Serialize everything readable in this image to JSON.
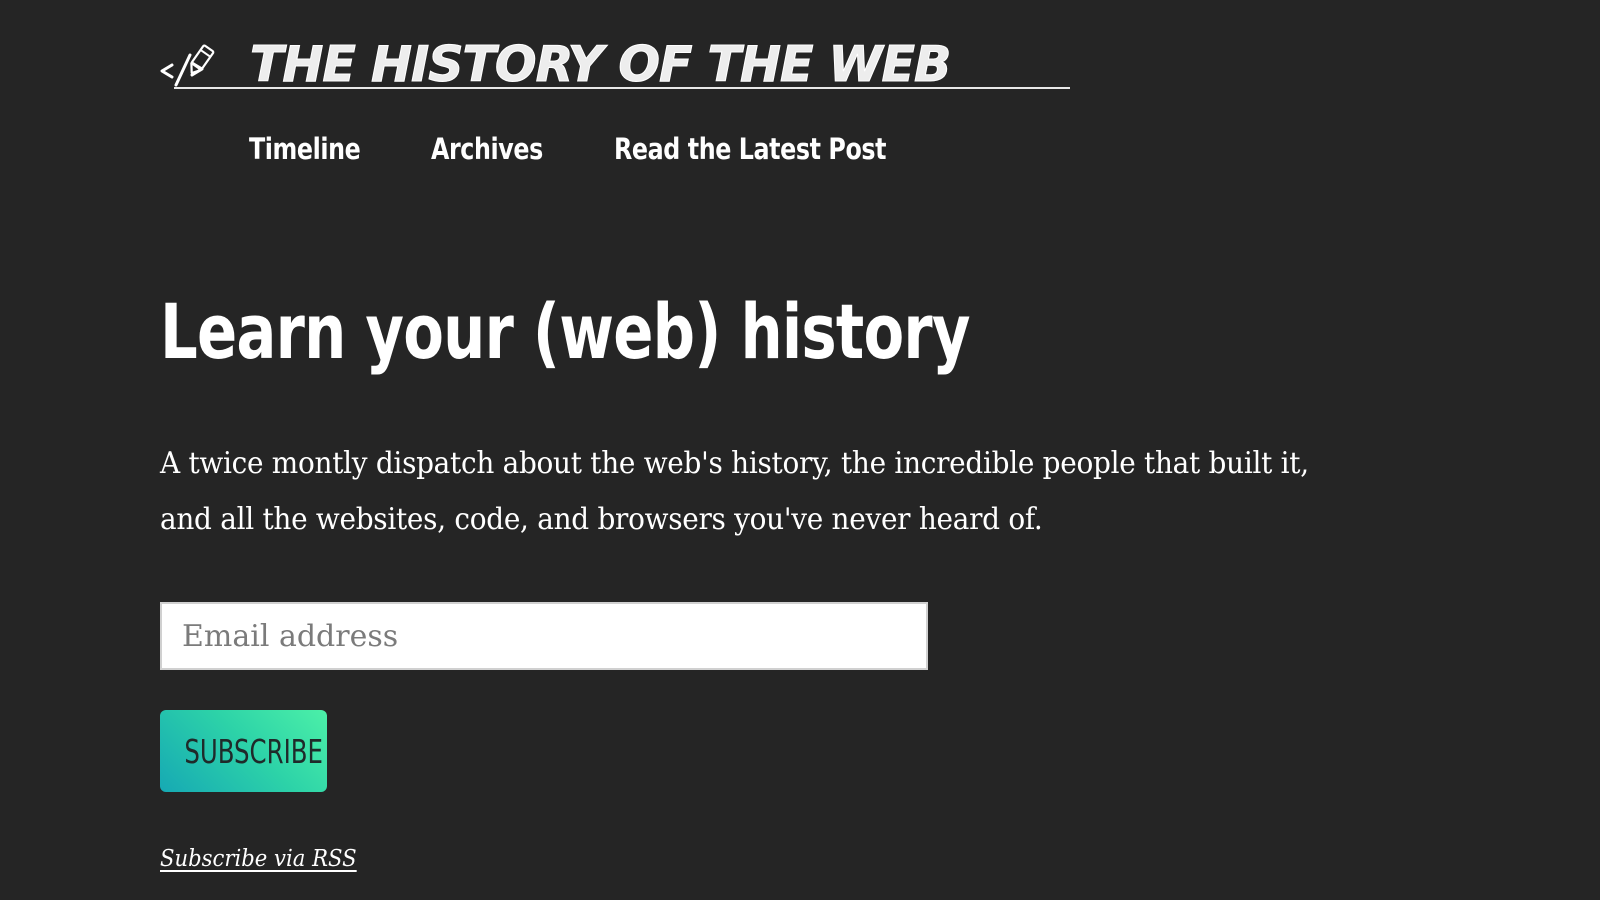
{
  "header": {
    "site_title": "THE HISTORY OF THE WEB",
    "logo_icon": "code-pencil-logo-icon"
  },
  "nav": {
    "bullet_icon": "circle-arrow-icon",
    "items": [
      {
        "label": "Timeline"
      },
      {
        "label": "Archives"
      },
      {
        "label": "Read the Latest Post"
      }
    ]
  },
  "hero": {
    "headline": "Learn your (web) history",
    "intro_line_1": "A twice montly dispatch about the web's history, the incredible people that built it,",
    "intro_line_2": "and all the websites, code, and browsers you've never heard of."
  },
  "form": {
    "email_placeholder": "Email address",
    "email_value": "",
    "subscribe_label": "SUBSCRIBE",
    "rss_link": "Subscribe via RSS"
  },
  "colors": {
    "background": "#252525",
    "text": "#ffffff",
    "button_gradient_start": "#16a9b4",
    "button_gradient_end": "#4cf0a8"
  }
}
